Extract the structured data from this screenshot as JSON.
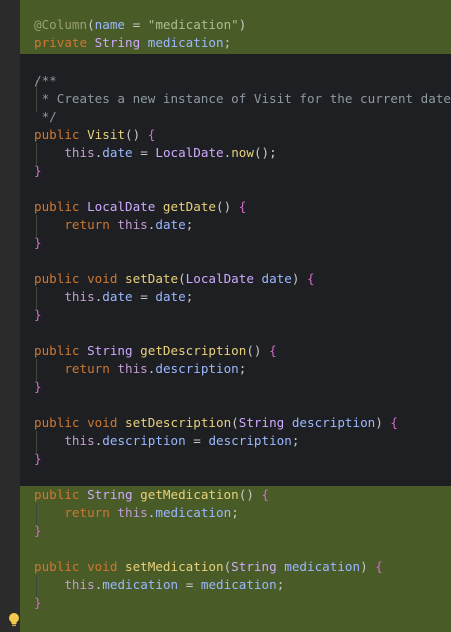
{
  "code": {
    "l1": {
      "ann": "@Column",
      "p1": "(",
      "attr": "name",
      "eq": " = ",
      "str": "\"medication\"",
      "p2": ")"
    },
    "l2": {
      "kw": "private ",
      "type": "String ",
      "name": "medication",
      "semi": ";"
    },
    "c1": "/**",
    "c2": " * Creates a new instance of Visit for the current date",
    "c3": " */",
    "l6": {
      "kw": "public ",
      "name": "Visit",
      "paren": "() ",
      "brace": "{"
    },
    "l7": {
      "this": "this",
      "dot": ".",
      "field": "date",
      "eq": " = ",
      "cls": "LocalDate",
      "dot2": ".",
      "call": "now",
      "paren": "()",
      "semi": ";"
    },
    "l8": "}",
    "l10": {
      "kw": "public ",
      "type": "LocalDate ",
      "name": "getDate",
      "paren": "() ",
      "brace": "{"
    },
    "l11": {
      "ret": "return ",
      "this": "this",
      "dot": ".",
      "field": "date",
      "semi": ";"
    },
    "l12": "}",
    "l14": {
      "kw": "public ",
      "kw2": "void ",
      "name": "setDate",
      "p1": "(",
      "type": "LocalDate ",
      "param": "date",
      "p2": ") ",
      "brace": "{"
    },
    "l15": {
      "this": "this",
      "dot": ".",
      "field": "date",
      "eq": " = ",
      "val": "date",
      "semi": ";"
    },
    "l16": "}",
    "l18": {
      "kw": "public ",
      "type": "String ",
      "name": "getDescription",
      "paren": "() ",
      "brace": "{"
    },
    "l19": {
      "ret": "return ",
      "this": "this",
      "dot": ".",
      "field": "description",
      "semi": ";"
    },
    "l20": "}",
    "l22": {
      "kw": "public ",
      "kw2": "void ",
      "name": "setDescription",
      "p1": "(",
      "type": "String ",
      "param": "description",
      "p2": ") ",
      "brace": "{"
    },
    "l23": {
      "this": "this",
      "dot": ".",
      "field": "description",
      "eq": " = ",
      "val": "description",
      "semi": ";"
    },
    "l24": "}",
    "l26": {
      "kw": "public ",
      "type": "String ",
      "name": "getMedication",
      "paren": "() ",
      "brace": "{"
    },
    "l27": {
      "ret": "return ",
      "this": "this",
      "dot": ".",
      "field": "medication",
      "semi": ";"
    },
    "l28": "}",
    "l30": {
      "kw": "public ",
      "kw2": "void ",
      "name": "setMedication",
      "p1": "(",
      "type": "String ",
      "param": "medication",
      "p2": ") ",
      "brace": "{"
    },
    "l31": {
      "this": "this",
      "dot": ".",
      "field": "medication",
      "eq": " = ",
      "val": "medication",
      "semi": ";"
    },
    "l32": "}"
  },
  "colors": {
    "editor_bg": "#1e1f22",
    "added_highlight": "#495b27",
    "gutter": "#2b2b2b",
    "bulb": "#f2c94c"
  },
  "icons": {
    "gutter_action": "lightbulb-icon"
  }
}
